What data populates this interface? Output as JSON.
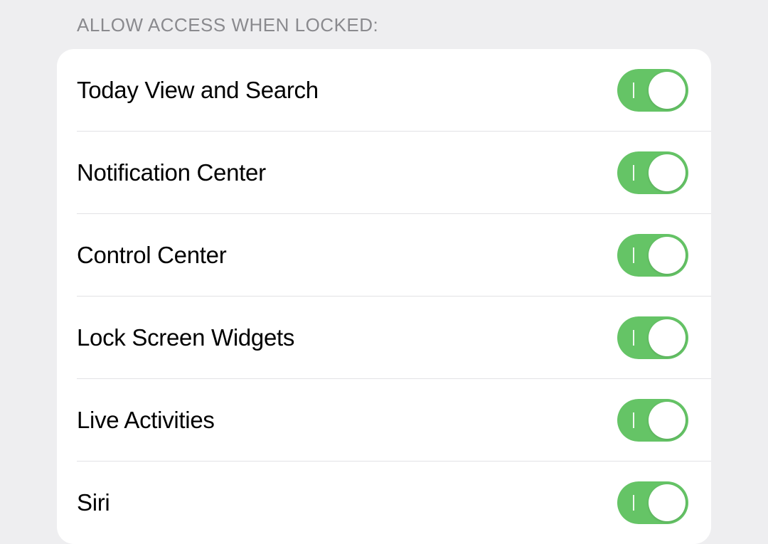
{
  "section": {
    "header": "ALLOW ACCESS WHEN LOCKED:",
    "items": [
      {
        "name": "today-view-and-search",
        "label": "Today View and Search",
        "on": true
      },
      {
        "name": "notification-center",
        "label": "Notification Center",
        "on": true
      },
      {
        "name": "control-center",
        "label": "Control Center",
        "on": true
      },
      {
        "name": "lock-screen-widgets",
        "label": "Lock Screen Widgets",
        "on": true
      },
      {
        "name": "live-activities",
        "label": "Live Activities",
        "on": true
      },
      {
        "name": "siri",
        "label": "Siri",
        "on": true
      }
    ]
  }
}
